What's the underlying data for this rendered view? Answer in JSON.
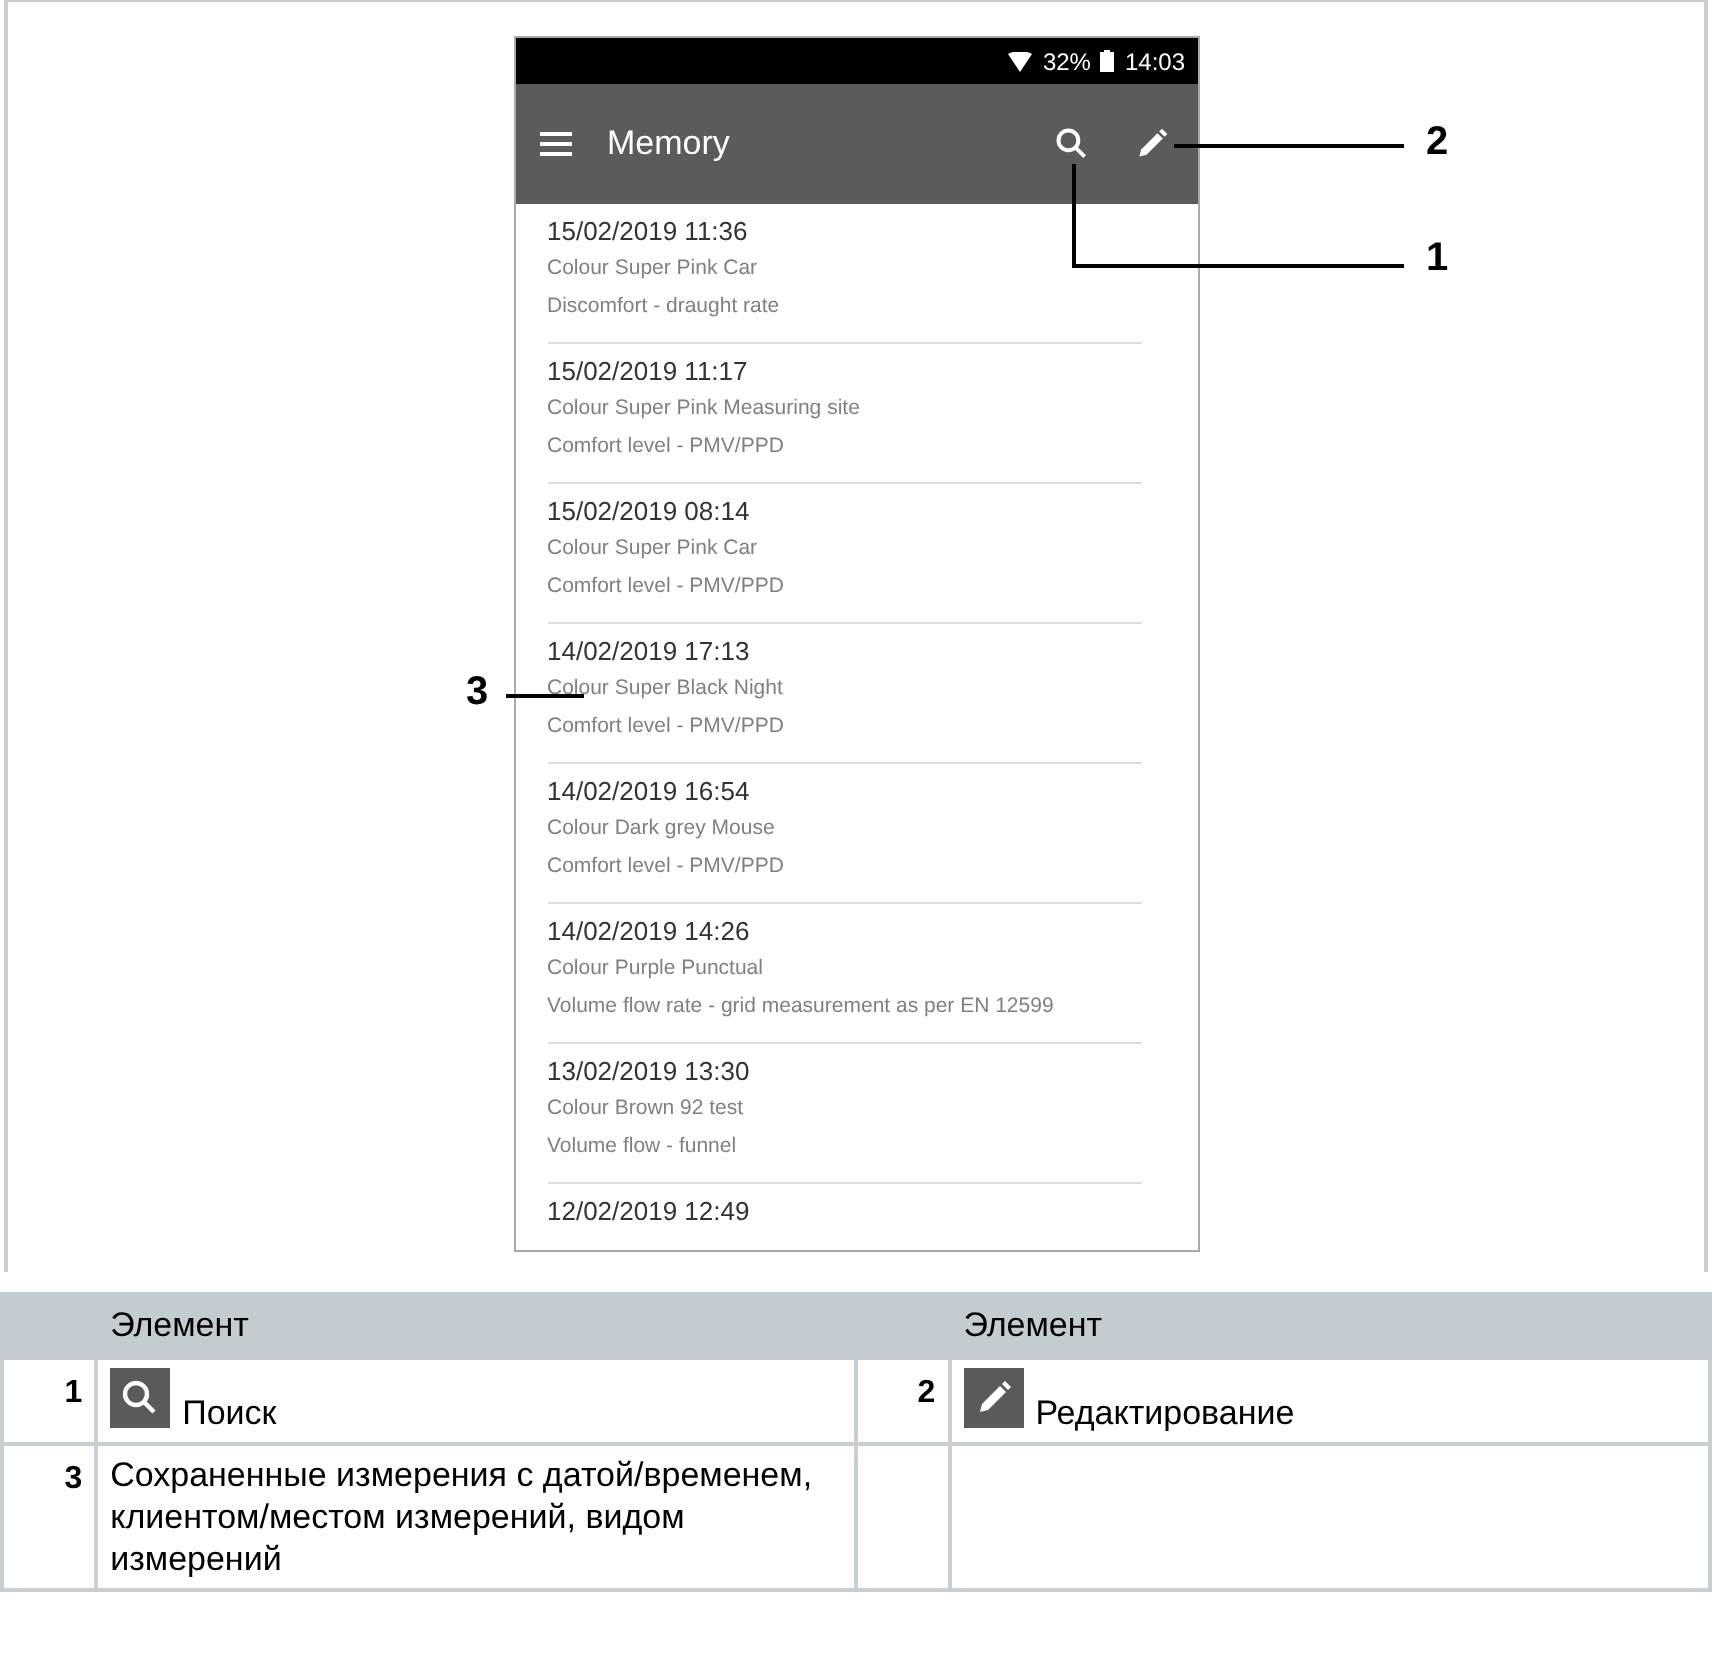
{
  "status_bar": {
    "battery": "32%",
    "time": "14:03"
  },
  "app_bar": {
    "title": "Memory"
  },
  "records": [
    {
      "datetime": "15/02/2019 11:36",
      "customer": "Colour Super Pink Car",
      "measurement": "Discomfort - draught rate"
    },
    {
      "datetime": "15/02/2019 11:17",
      "customer": "Colour Super Pink Measuring site",
      "measurement": "Comfort level - PMV/PPD"
    },
    {
      "datetime": "15/02/2019 08:14",
      "customer": "Colour Super Pink Car",
      "measurement": "Comfort level - PMV/PPD"
    },
    {
      "datetime": "14/02/2019 17:13",
      "customer": "Colour Super Black Night",
      "measurement": "Comfort level - PMV/PPD"
    },
    {
      "datetime": "14/02/2019 16:54",
      "customer": "Colour Dark grey Mouse",
      "measurement": "Comfort level - PMV/PPD"
    },
    {
      "datetime": "14/02/2019 14:26",
      "customer": "Colour Purple Punctual",
      "measurement": "Volume flow rate - grid measurement as per EN 12599"
    },
    {
      "datetime": "13/02/2019 13:30",
      "customer": "Colour Brown 92 test",
      "measurement": "Volume flow - funnel"
    },
    {
      "datetime": "12/02/2019 12:49"
    }
  ],
  "callouts": [
    {
      "label": "1"
    },
    {
      "label": "2"
    },
    {
      "label": "3"
    }
  ],
  "legend_table": {
    "headers": [
      "Элемент",
      "Элемент"
    ],
    "rows": [
      {
        "cells": [
          {
            "number": "1",
            "kind": "search",
            "text": "Поиск"
          },
          {
            "number": "2",
            "kind": "edit",
            "text": "Редактирование"
          }
        ]
      },
      {
        "cells": [
          {
            "number": "3",
            "kind": "plain",
            "text": "Сохраненные измерения с датой/временем, клиентом/местом измерений, видом измерений"
          }
        ]
      }
    ]
  }
}
